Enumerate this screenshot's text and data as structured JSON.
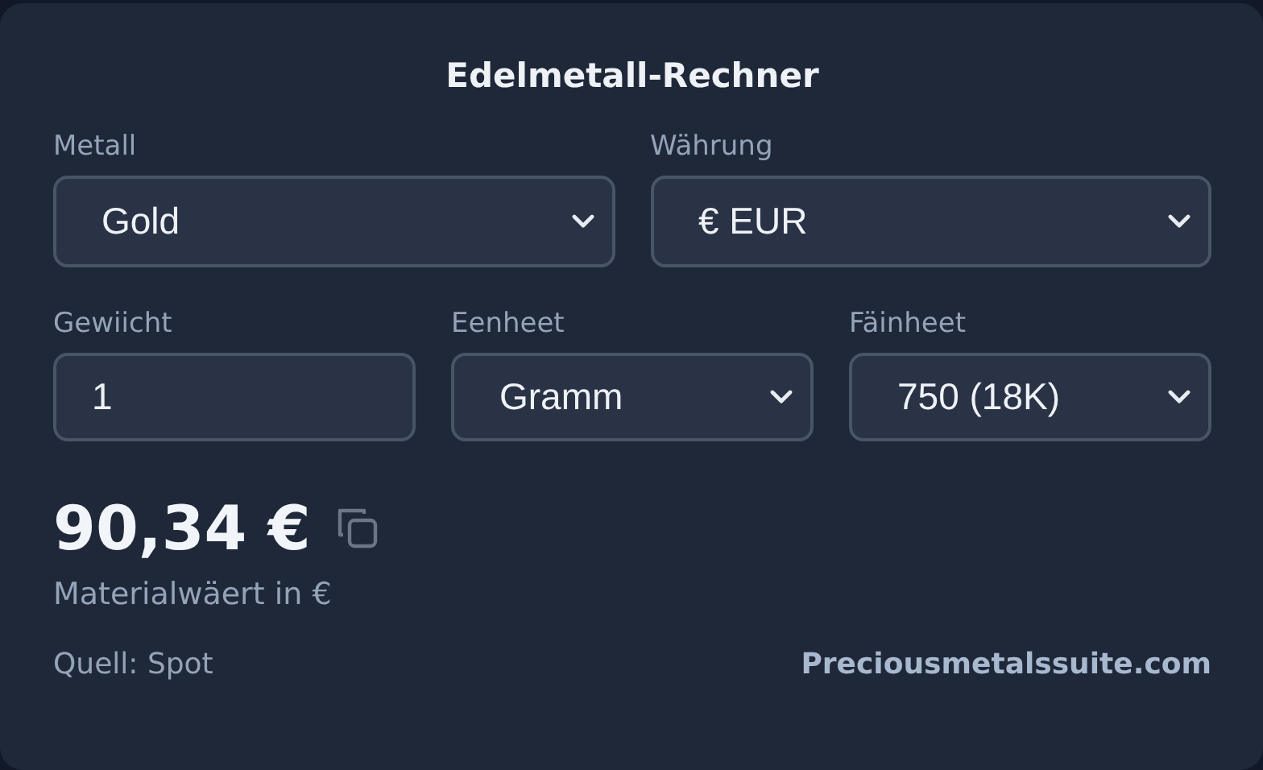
{
  "title": "Edelmetall-Rechner",
  "rows": [
    [
      {
        "kind": "select",
        "label": "Metall",
        "value": "Gold"
      },
      {
        "kind": "select",
        "label": "Währung",
        "value": "€ EUR"
      }
    ],
    [
      {
        "kind": "input",
        "label": "Gewiicht",
        "value": "1"
      },
      {
        "kind": "select",
        "label": "Eenheet",
        "value": "Gramm"
      },
      {
        "kind": "select",
        "label": "Fäinheet",
        "value": "750 (18K)"
      }
    ]
  ],
  "result": {
    "value": "90,34 €",
    "caption": "Materialwäert in €"
  },
  "footer": {
    "source": "Quell: Spot",
    "link": "Preciousmetalssuite.com"
  }
}
